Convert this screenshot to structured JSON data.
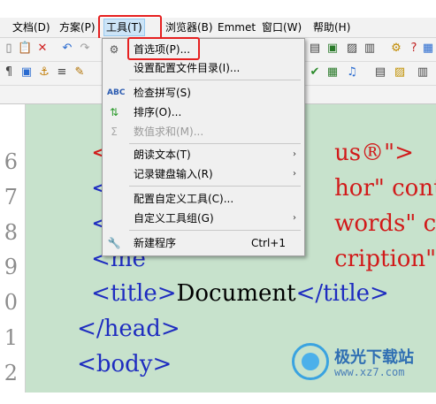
{
  "menubar": {
    "items": [
      {
        "label": "文档(D)"
      },
      {
        "label": "方案(P)"
      },
      {
        "label": "工具(T)"
      },
      {
        "label": "浏览器(B)"
      },
      {
        "label": "Emmet"
      },
      {
        "label": "窗口(W)"
      },
      {
        "label": "帮助(H)"
      }
    ],
    "active": "工具(T)"
  },
  "tools_menu": {
    "items": [
      {
        "label": "首选项(P)...",
        "icon": "gear-icon",
        "enabled": true,
        "highlighted": true
      },
      {
        "label": "设置配置文件目录(I)...",
        "icon": "",
        "enabled": true
      },
      {
        "label": "检查拼写(S)",
        "icon": "spellcheck-icon",
        "enabled": true
      },
      {
        "label": "排序(O)...",
        "icon": "sort-icon",
        "enabled": true
      },
      {
        "label": "数值求和(M)...",
        "icon": "sum-icon",
        "enabled": false
      },
      {
        "label": "朗读文本(T)",
        "icon": "",
        "enabled": true,
        "submenu": true
      },
      {
        "label": "记录键盘输入(R)",
        "icon": "",
        "enabled": true,
        "submenu": true
      },
      {
        "label": "配置自定义工具(C)...",
        "icon": "",
        "enabled": true
      },
      {
        "label": "自定义工具组(G)",
        "icon": "",
        "enabled": true,
        "submenu": true
      },
      {
        "label": "新建程序",
        "icon": "wrench-icon",
        "enabled": true,
        "shortcut": "Ctrl+1"
      }
    ]
  },
  "editor": {
    "line_numbers": [
      "6",
      "7",
      "8",
      "9",
      "0",
      "1",
      "2"
    ],
    "lines": [
      {
        "tag": "<con",
        "attr": "",
        "rest": "us®\">"
      },
      {
        "tag": "<me",
        "attr": "hor\" cont",
        "rest": ""
      },
      {
        "tag": "<me",
        "attr": "words\" co",
        "rest": ""
      },
      {
        "tag": "<me",
        "attr": "cription\"",
        "rest": ""
      },
      {
        "tag": "<title>",
        "text": "Document",
        "close": "</title>"
      },
      {
        "tag": "</head>"
      },
      {
        "tag": "<body>"
      }
    ]
  },
  "watermark": {
    "name": "极光下载站",
    "url": "www.xz7.com"
  },
  "colors": {
    "highlight": "#e62020",
    "editor_bg": "#c7e2cc",
    "tag": "#1e2cc0",
    "attr": "#d11a1a"
  }
}
